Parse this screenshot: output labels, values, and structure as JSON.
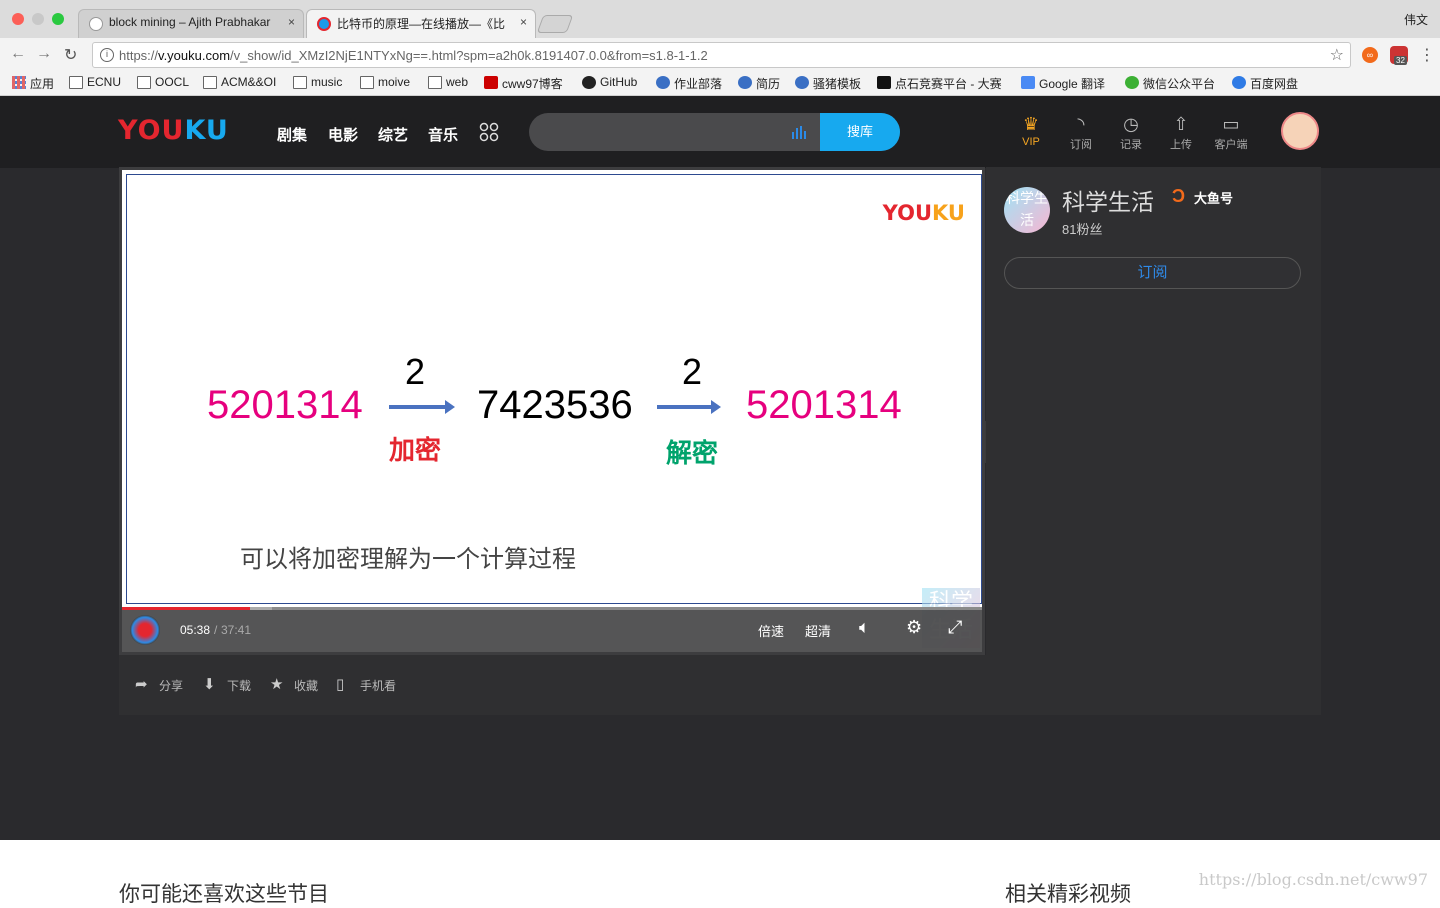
{
  "browser": {
    "tabs": [
      {
        "title": "block mining – Ajith Prabhakar",
        "active": false
      },
      {
        "title": "比特币的原理—在线播放—《比",
        "active": true
      }
    ],
    "close_glyph": "×",
    "user": "伟文",
    "url_prefix": "https://",
    "url_domain": "v.youku.com",
    "url_rest": "/v_show/id_XMzI2NjE1NTYxNg==.html?spm=a2h0k.8191407.0.0&from=s1.8-1-1.2",
    "ext_badge": "32",
    "bookmarks": [
      {
        "label": "应用",
        "icon": "apps-grid-icon"
      },
      {
        "label": "ECNU",
        "icon": "folder-icon"
      },
      {
        "label": "OOCL",
        "icon": "folder-icon"
      },
      {
        "label": "ACM&&OI",
        "icon": "folder-icon"
      },
      {
        "label": "music",
        "icon": "folder-icon"
      },
      {
        "label": "moive",
        "icon": "folder-icon"
      },
      {
        "label": "web",
        "icon": "folder-icon"
      },
      {
        "label": "cww97博客",
        "icon": "csdn-icon"
      },
      {
        "label": "GitHub",
        "icon": "github-icon"
      },
      {
        "label": "作业部落",
        "icon": "zybuluo-icon"
      },
      {
        "label": "简历",
        "icon": "zybuluo-icon"
      },
      {
        "label": "骚猪模板",
        "icon": "zybuluo-icon"
      },
      {
        "label": "点石竞赛平台 - 大赛",
        "icon": "dianshi-icon"
      },
      {
        "label": "Google 翻译",
        "icon": "google-translate-icon"
      },
      {
        "label": "微信公众平台",
        "icon": "wechat-icon"
      },
      {
        "label": "百度网盘",
        "icon": "baidu-pan-icon"
      }
    ]
  },
  "youku": {
    "logo": "YOUKU",
    "nav": [
      "剧集",
      "电影",
      "综艺",
      "音乐"
    ],
    "search_button": "搜库",
    "tools": [
      {
        "label": "VIP",
        "icon": "crown-icon"
      },
      {
        "label": "订阅",
        "icon": "rss-icon"
      },
      {
        "label": "记录",
        "icon": "clock-icon"
      },
      {
        "label": "上传",
        "icon": "upload-icon"
      },
      {
        "label": "客户端",
        "icon": "monitor-icon"
      }
    ],
    "colors": {
      "brand_red": "#e4262f",
      "brand_blue": "#17a9ef",
      "magenta": "#e6007e",
      "green": "#00a36c"
    }
  },
  "video": {
    "slide": {
      "watermark": "YOUKU",
      "left_number": "5201314",
      "middle_number": "7423536",
      "right_number": "5201314",
      "key_left": "2",
      "key_right": "2",
      "encrypt_label": "加密",
      "decrypt_label": "解密"
    },
    "current_time": "05:38",
    "duration": "37:41",
    "progress_fraction": 0.149,
    "subtitle": "可以将加密理解为一个计算过程",
    "speed_label": "倍速",
    "quality_label": "超清",
    "corner_watermark": "科学生活"
  },
  "channel": {
    "avatar_text": "科学生活",
    "name": "科学生活",
    "platform": "大鱼号",
    "fans": "81粉丝",
    "subscribe": "订阅"
  },
  "actions": [
    {
      "label": "分享",
      "icon": "share-icon"
    },
    {
      "label": "下载",
      "icon": "download-icon"
    },
    {
      "label": "收藏",
      "icon": "star-icon"
    },
    {
      "label": "手机看",
      "icon": "phone-icon"
    }
  ],
  "sections": {
    "recommend_title": "你可能还喜欢这些节目",
    "related_title": "相关精彩视频",
    "watermark": "https://blog.csdn.net/cww97"
  }
}
